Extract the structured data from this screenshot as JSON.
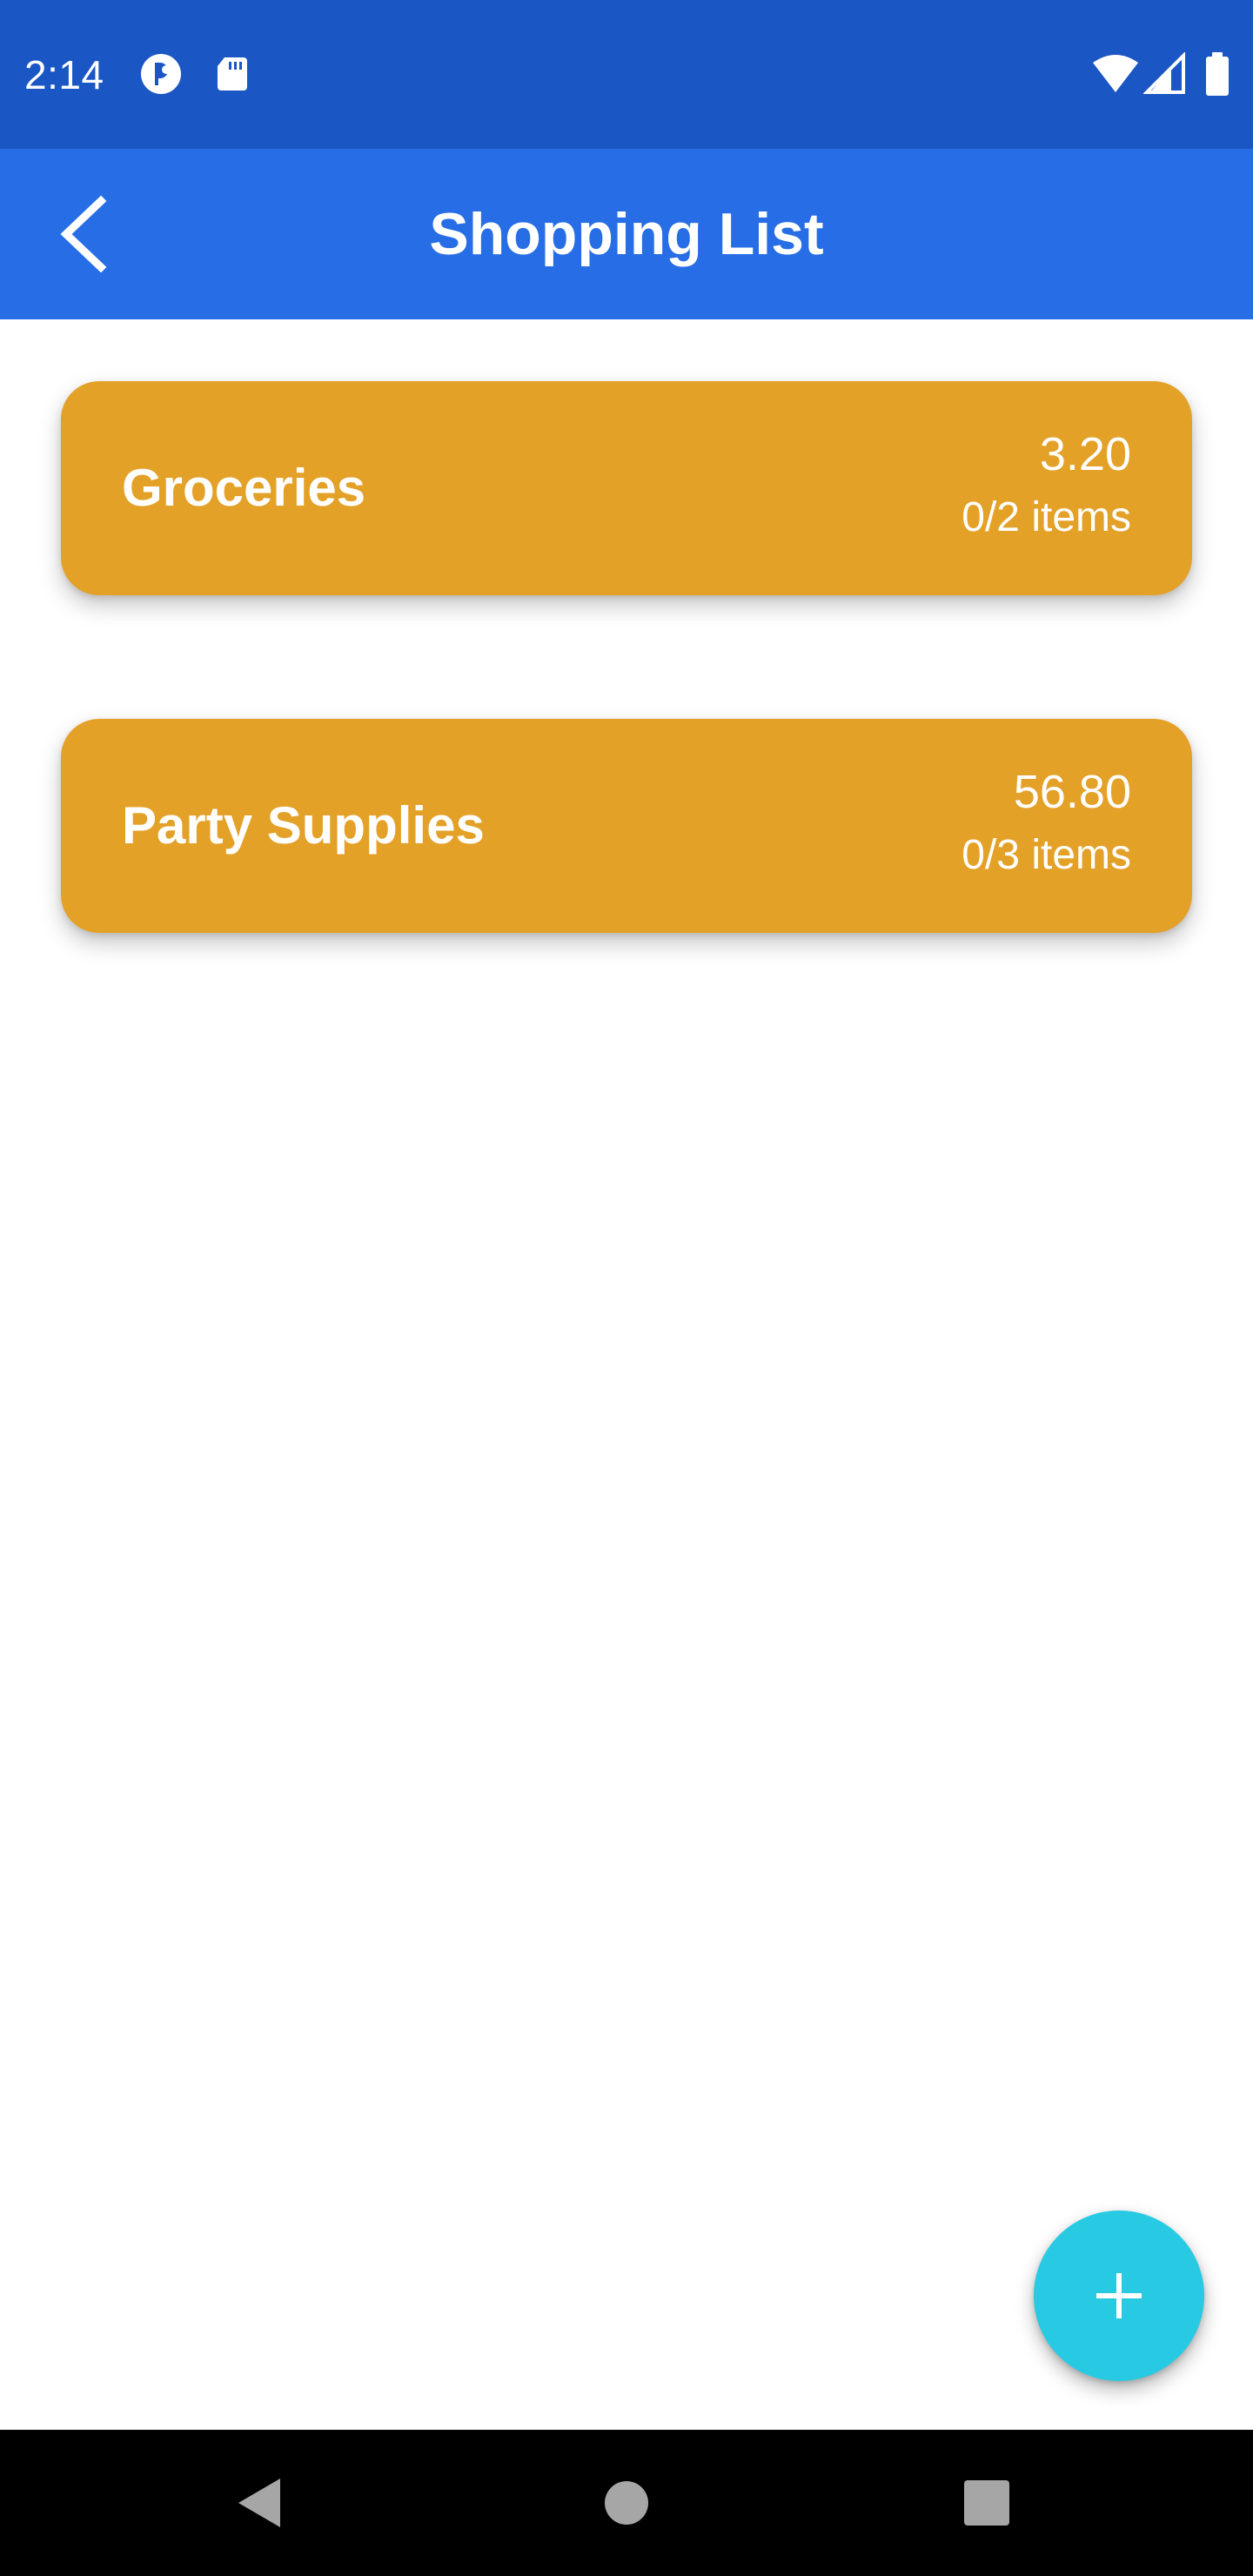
{
  "status_bar": {
    "time": "2:14",
    "left_icons": [
      "privacy-indicator-icon",
      "sd-card-icon"
    ],
    "right_icons": [
      "wifi-icon",
      "cell-signal-icon",
      "battery-icon"
    ]
  },
  "app_bar": {
    "title": "Shopping List",
    "back_icon": "chevron-left-icon"
  },
  "lists": [
    {
      "name": "Groceries",
      "total": "3.20",
      "count": "0/2 items"
    },
    {
      "name": "Party Supplies",
      "total": "56.80",
      "count": "0/3 items"
    }
  ],
  "fab": {
    "icon": "plus-icon"
  },
  "nav_bar": {
    "icons": [
      "back-triangle-icon",
      "home-circle-icon",
      "recents-square-icon"
    ]
  },
  "colors": {
    "status_bar": "#1a56c4",
    "app_bar": "#276ee6",
    "card": "#e4a128",
    "fab": "#27c9e3",
    "nav_bar": "#000000"
  }
}
